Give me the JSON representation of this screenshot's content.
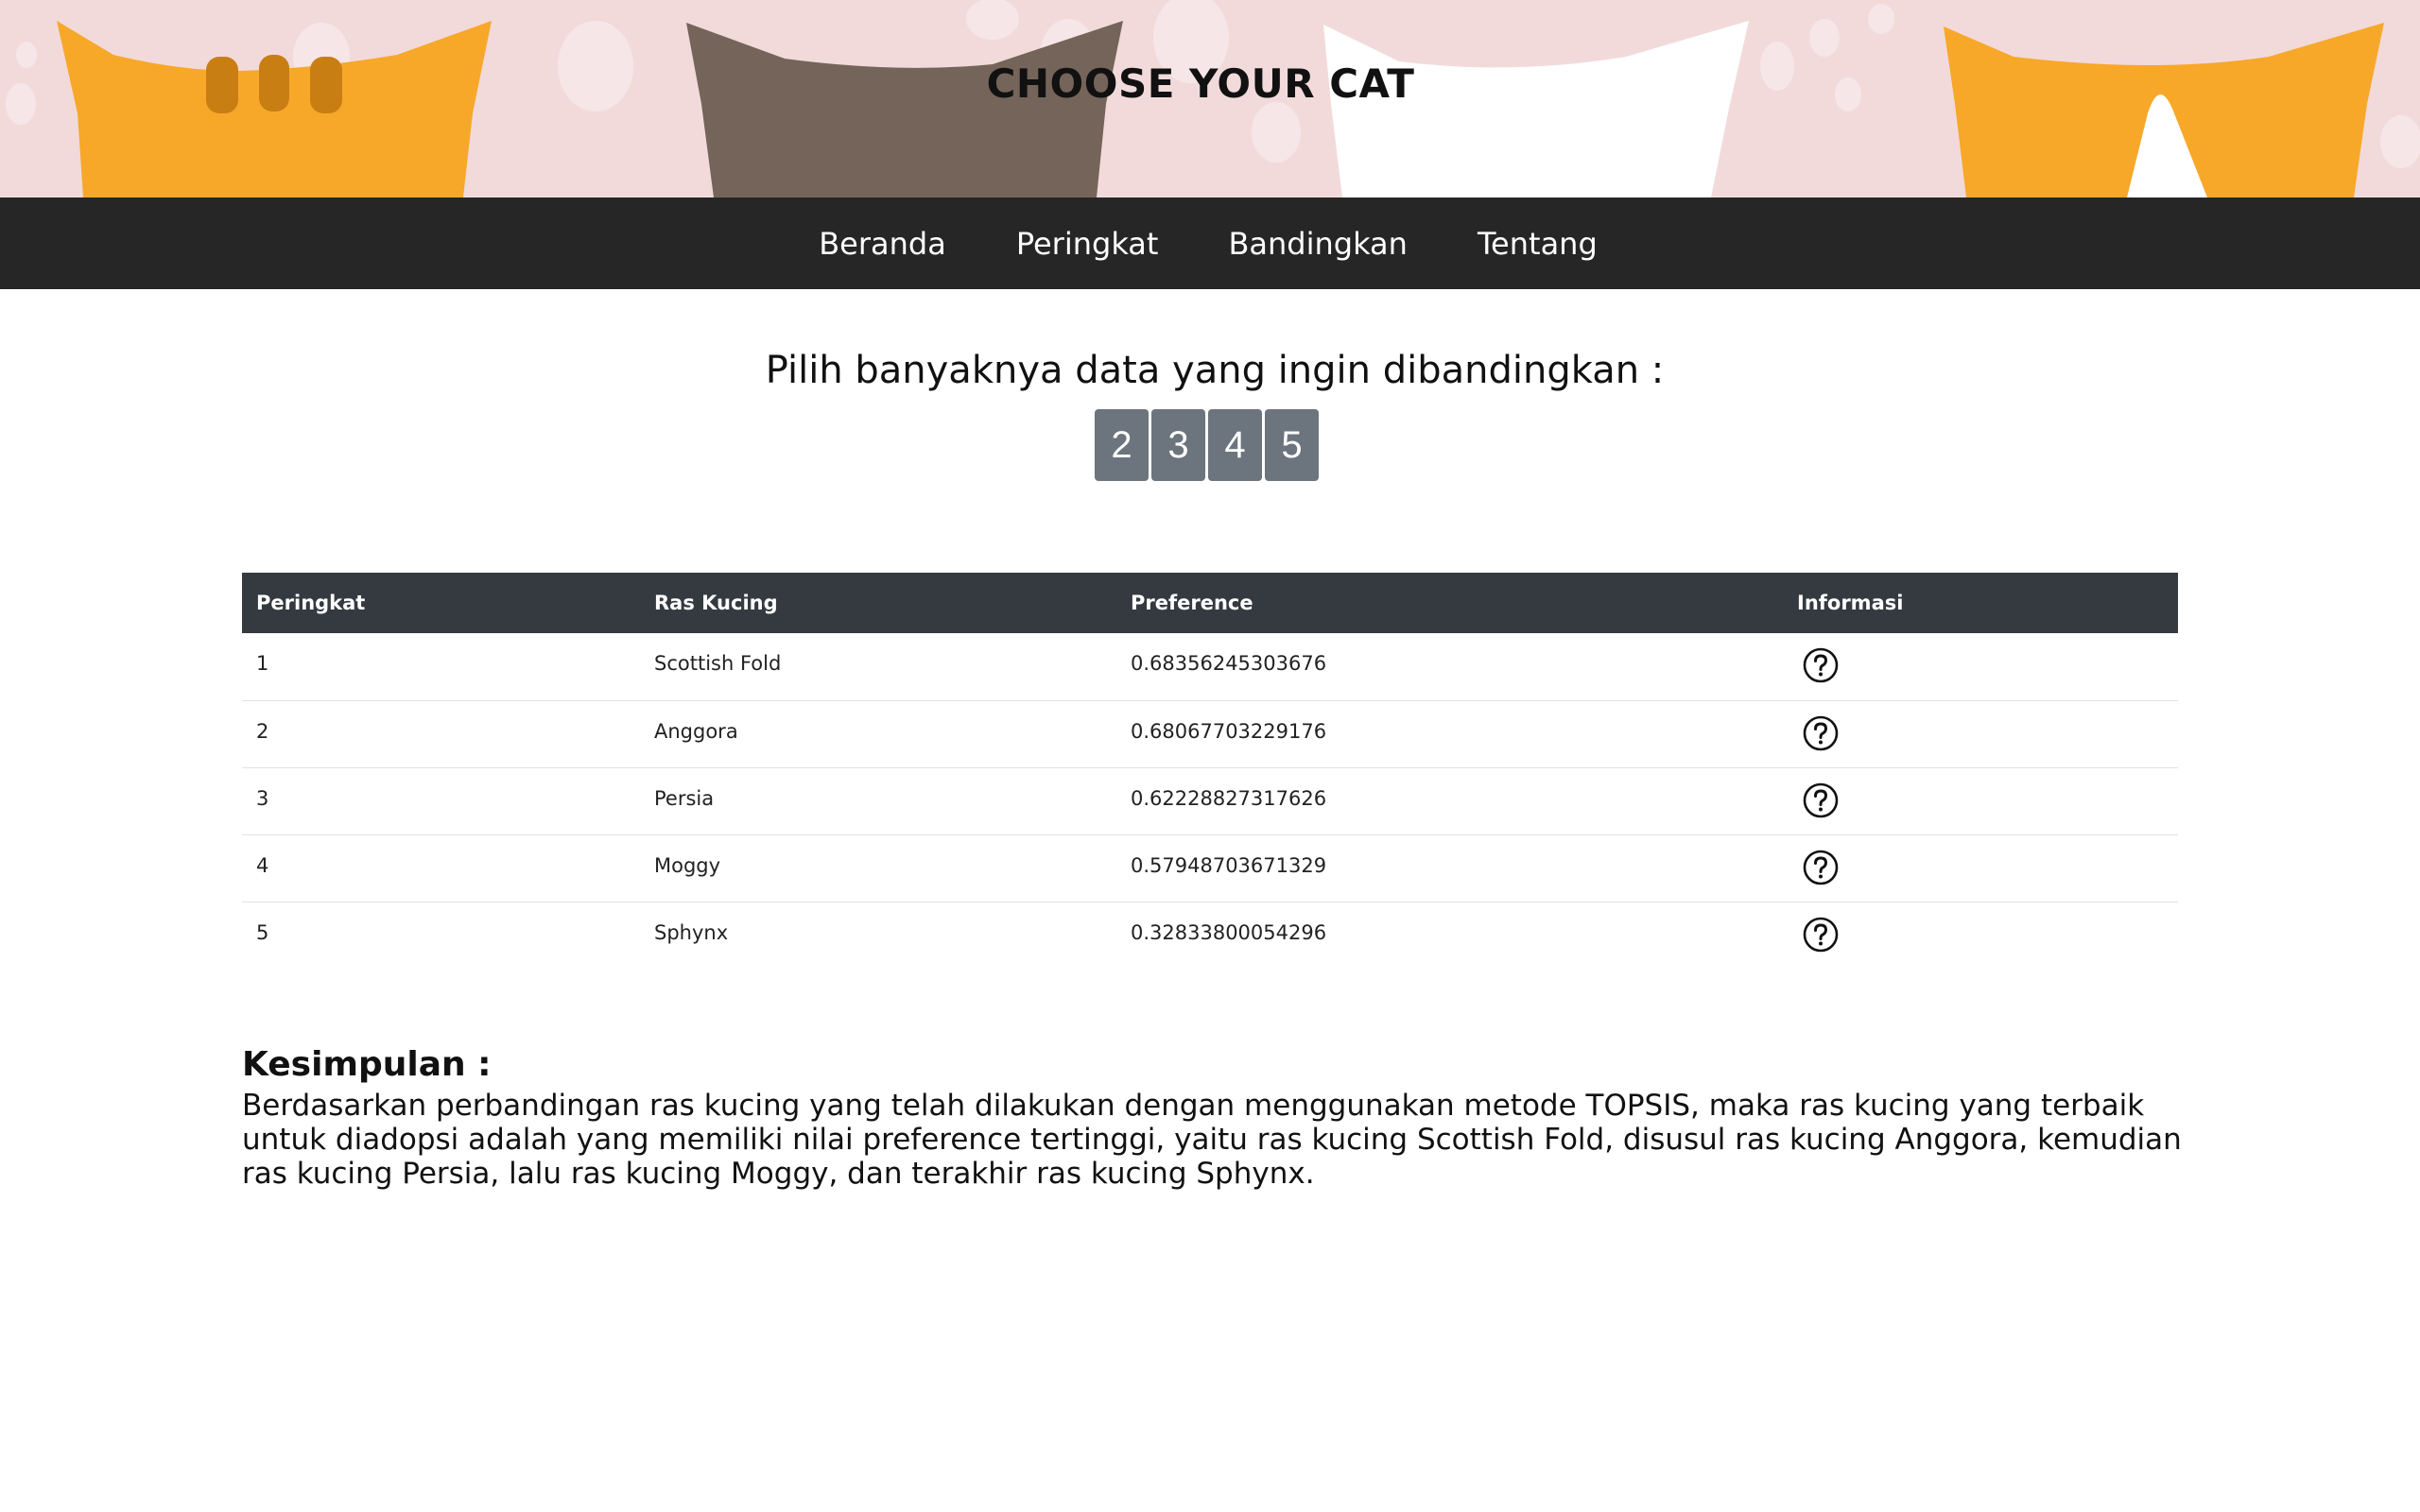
{
  "header": {
    "title": "CHOOSE YOUR CAT"
  },
  "nav": {
    "items": [
      {
        "label": "Beranda"
      },
      {
        "label": "Peringkat"
      },
      {
        "label": "Bandingkan"
      },
      {
        "label": "Tentang"
      }
    ]
  },
  "compare": {
    "prompt": "Pilih banyaknya data yang ingin dibandingkan :",
    "options": [
      "2",
      "3",
      "4",
      "5"
    ]
  },
  "table": {
    "headers": [
      "Peringkat",
      "Ras Kucing",
      "Preference",
      "Informasi"
    ],
    "rows": [
      {
        "rank": "1",
        "breed": "Scottish Fold",
        "preference": "0.68356245303676",
        "info_icon": "question-circle-icon"
      },
      {
        "rank": "2",
        "breed": "Anggora",
        "preference": "0.68067703229176",
        "info_icon": "question-circle-icon"
      },
      {
        "rank": "3",
        "breed": "Persia",
        "preference": "0.62228827317626",
        "info_icon": "question-circle-icon"
      },
      {
        "rank": "4",
        "breed": "Moggy",
        "preference": "0.57948703671329",
        "info_icon": "question-circle-icon"
      },
      {
        "rank": "5",
        "breed": "Sphynx",
        "preference": "0.32833800054296",
        "info_icon": "question-circle-icon"
      }
    ]
  },
  "conclusion": {
    "title": "Kesimpulan :",
    "text": "Berdasarkan perbandingan ras kucing yang telah dilakukan dengan menggunakan metode TOPSIS, maka ras kucing yang terbaik untuk diadopsi adalah yang memiliki nilai preference tertinggi, yaitu ras kucing Scottish Fold, disusul ras kucing Anggora, kemudian ras kucing Persia, lalu ras kucing Moggy, dan terakhir ras kucing Sphynx."
  },
  "colors": {
    "header_bg": "#f2dadb",
    "navbar_bg": "#262626",
    "table_header_bg": "#343a40",
    "count_button_bg": "#6c757d",
    "cat_orange": "#f7a829",
    "cat_brown": "#74645a",
    "cat_white": "#ffffff"
  }
}
